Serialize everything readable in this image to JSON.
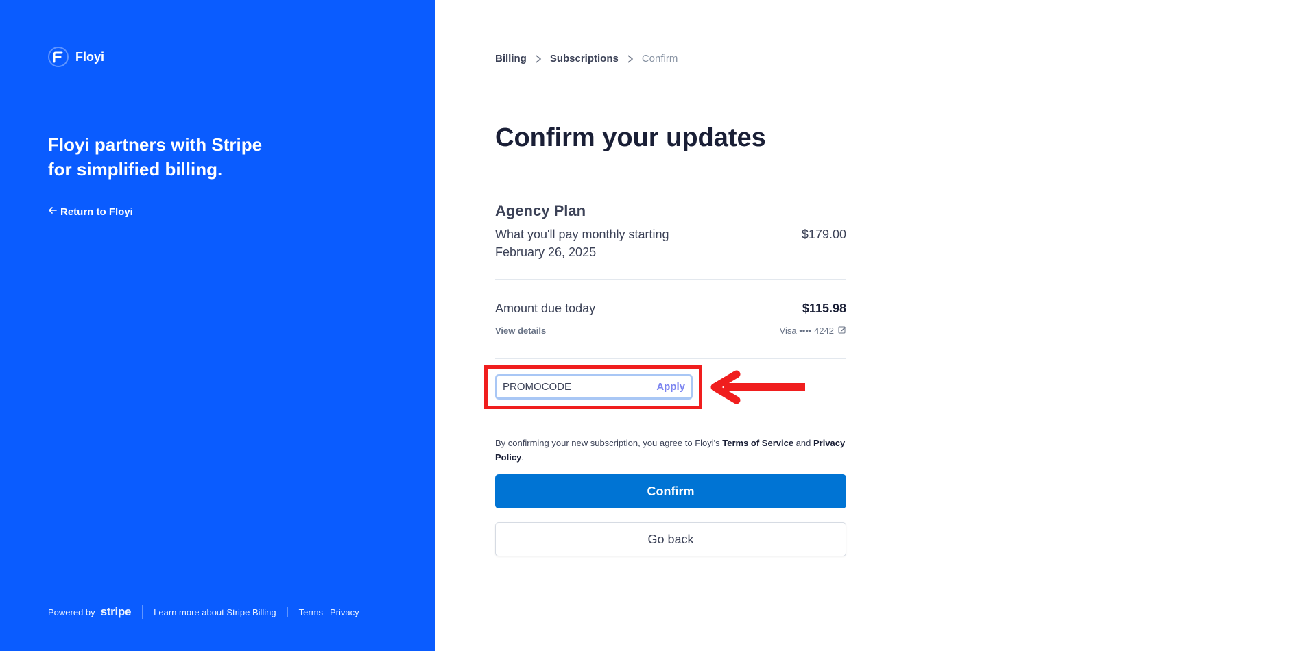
{
  "brand": {
    "name": "Floyi",
    "logo_icon": "floyi-logo-icon"
  },
  "left": {
    "tagline": "Floyi partners with Stripe for simplified billing.",
    "return_link": "Return to Floyi",
    "footer": {
      "powered_by": "Powered by",
      "stripe": "stripe",
      "learn_more": "Learn more about Stripe Billing",
      "terms": "Terms",
      "privacy": "Privacy"
    }
  },
  "breadcrumb": {
    "billing": "Billing",
    "subscriptions": "Subscriptions",
    "confirm": "Confirm"
  },
  "page_title": "Confirm your updates",
  "plan": {
    "name": "Agency Plan",
    "description": "What you'll pay monthly starting February 26, 2025",
    "price": "$179.00"
  },
  "due": {
    "label": "Amount due today",
    "amount": "$115.98",
    "view_details": "View details",
    "card": "Visa •••• 4242"
  },
  "promo": {
    "value": "PROMOCODE",
    "apply": "Apply"
  },
  "legal": {
    "prefix": "By confirming your new subscription, you agree to Floyi's ",
    "terms": "Terms of Service",
    "and": " and ",
    "privacy": "Privacy Policy",
    "suffix": "."
  },
  "buttons": {
    "confirm": "Confirm",
    "go_back": "Go back"
  },
  "colors": {
    "panel_blue": "#0a5cff",
    "confirm_blue": "#0074d4",
    "highlight_red": "#f01e1e",
    "apply_purple": "#7b84f0"
  }
}
